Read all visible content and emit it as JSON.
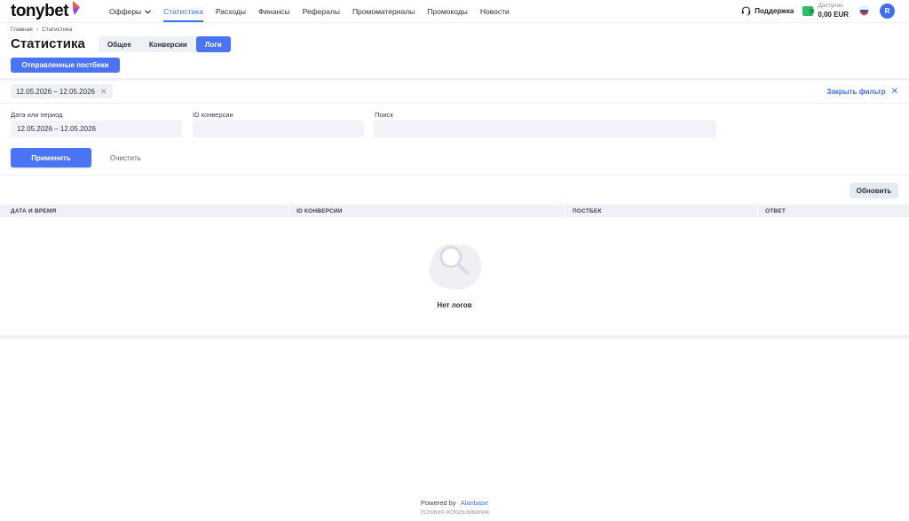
{
  "brand": {
    "name": "tonybet",
    "accent": "#3e6ff0",
    "mark_colors": [
      "#f0573b",
      "#8a3ff0"
    ]
  },
  "nav": {
    "items": [
      {
        "label": "Офферы",
        "has_dropdown": true,
        "active": false
      },
      {
        "label": "Статистика",
        "active": true
      },
      {
        "label": "Расходы",
        "active": false
      },
      {
        "label": "Финансы",
        "active": false
      },
      {
        "label": "Рефералы",
        "active": false
      },
      {
        "label": "Промоматериалы",
        "active": false
      },
      {
        "label": "Промокоды",
        "active": false
      },
      {
        "label": "Новости",
        "active": false
      }
    ]
  },
  "header_right": {
    "support_label": "Поддержка",
    "balance_label": "Доступно",
    "balance_value": "0,00 EUR",
    "avatar_letter": "R",
    "flag": "ru"
  },
  "breadcrumb": {
    "home": "Главная",
    "current": "Статистика"
  },
  "page": {
    "title": "Статистика",
    "tabs": [
      {
        "label": "Общее",
        "active": false
      },
      {
        "label": "Конверсии",
        "active": false
      },
      {
        "label": "Логи",
        "active": true
      }
    ],
    "postbacks_button": "Отправленные постбеки"
  },
  "filter": {
    "chip_label": "12.05.2026 – 12.05.2026",
    "close_filter_label": "Закрыть фильтр",
    "fields": [
      {
        "label": "Дата или период",
        "value": "12.05.2026 – 12.05.2026"
      },
      {
        "label": "ID конверсии",
        "value": ""
      },
      {
        "label": "Поиск",
        "value": ""
      }
    ],
    "apply_label": "Применить",
    "clear_label": "Очистить"
  },
  "table": {
    "refresh_label": "Обновить",
    "columns": [
      "ДАТА И ВРЕМЯ",
      "ID КОНВЕРСИИ",
      "ПОСТБЕК",
      "ОТВЕТ"
    ],
    "empty_text": "Нет логов",
    "empty_icon": "search-magnifier-icon"
  },
  "footer": {
    "powered_by": "Powered by",
    "powered_link": "Alanbase",
    "terms": "Условия использования"
  }
}
